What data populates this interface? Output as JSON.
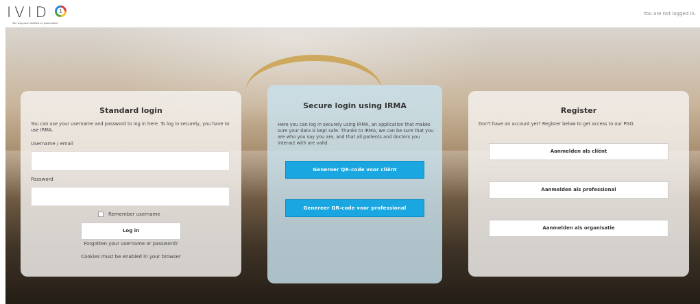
{
  "header": {
    "logo_text": "IVID",
    "logo_mark": "1",
    "logo_tagline": "Van weg naar vitaliteit en gezondheid",
    "login_status": "You are not logged in."
  },
  "standard_login": {
    "title": "Standard login",
    "description": "You can use your username and password to log in here. To log in securely, you have to use IRMA.",
    "username_label": "Username / email",
    "username_value": "",
    "password_label": "Password",
    "password_value": "",
    "remember_label": "Remember username",
    "remember_checked": false,
    "login_button": "Log in",
    "forgot_link": "Forgotten your username or password?",
    "cookies_notice": "Cookies must be enabled in your browser"
  },
  "irma_login": {
    "title": "Secure login using IRMA",
    "description": "Here you can log in securely using IRMA, an application that makes sure your data is kept safe. Thanks to IRMA, we can be sure that you are who you say you are, and that all patients and doctors you interact with are valid.",
    "client_button": "Genereer QR-code voor cliënt",
    "professional_button": "Genereer QR-code voor professional",
    "accent_color": "#1aa6e0"
  },
  "register": {
    "title": "Register",
    "description": "Don't have an account yet? Register below to get access to our PGO.",
    "buttons": [
      {
        "label": "Aanmelden als cliënt"
      },
      {
        "label": "Aanmelden als professional"
      },
      {
        "label": "Aanmelden als organisatie"
      }
    ]
  }
}
